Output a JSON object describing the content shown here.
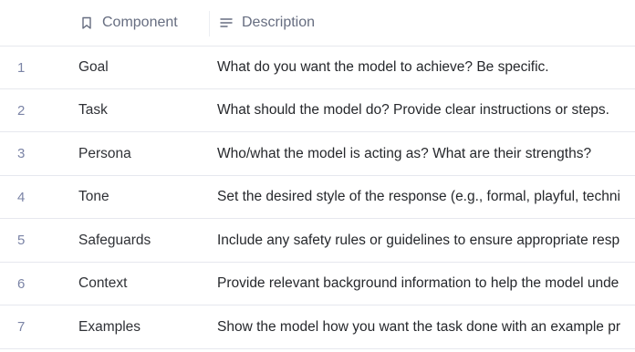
{
  "header": {
    "component_label": "Component",
    "description_label": "Description"
  },
  "rows": [
    {
      "num": "1",
      "component": "Goal",
      "description": "What do you want the model to achieve? Be specific."
    },
    {
      "num": "2",
      "component": "Task",
      "description": "What should the model do? Provide clear instructions or steps."
    },
    {
      "num": "3",
      "component": "Persona",
      "description": "Who/what the model is acting as? What are their strengths?"
    },
    {
      "num": "4",
      "component": "Tone",
      "description": "Set the desired style of the response (e.g., formal, playful, techni"
    },
    {
      "num": "5",
      "component": "Safeguards",
      "description": "Include any safety rules or guidelines to ensure appropriate resp"
    },
    {
      "num": "6",
      "component": "Context",
      "description": "Provide relevant background information to help the model unde"
    },
    {
      "num": "7",
      "component": "Examples",
      "description": "Show the model how you want the task done with an example pr"
    }
  ],
  "icons": {
    "component_header_icon": "bookmark-icon",
    "description_header_icon": "text-lines-icon"
  },
  "colors": {
    "row_number": "#7b84a6",
    "header_text": "#666d80",
    "divider": "#e6e8ee"
  }
}
